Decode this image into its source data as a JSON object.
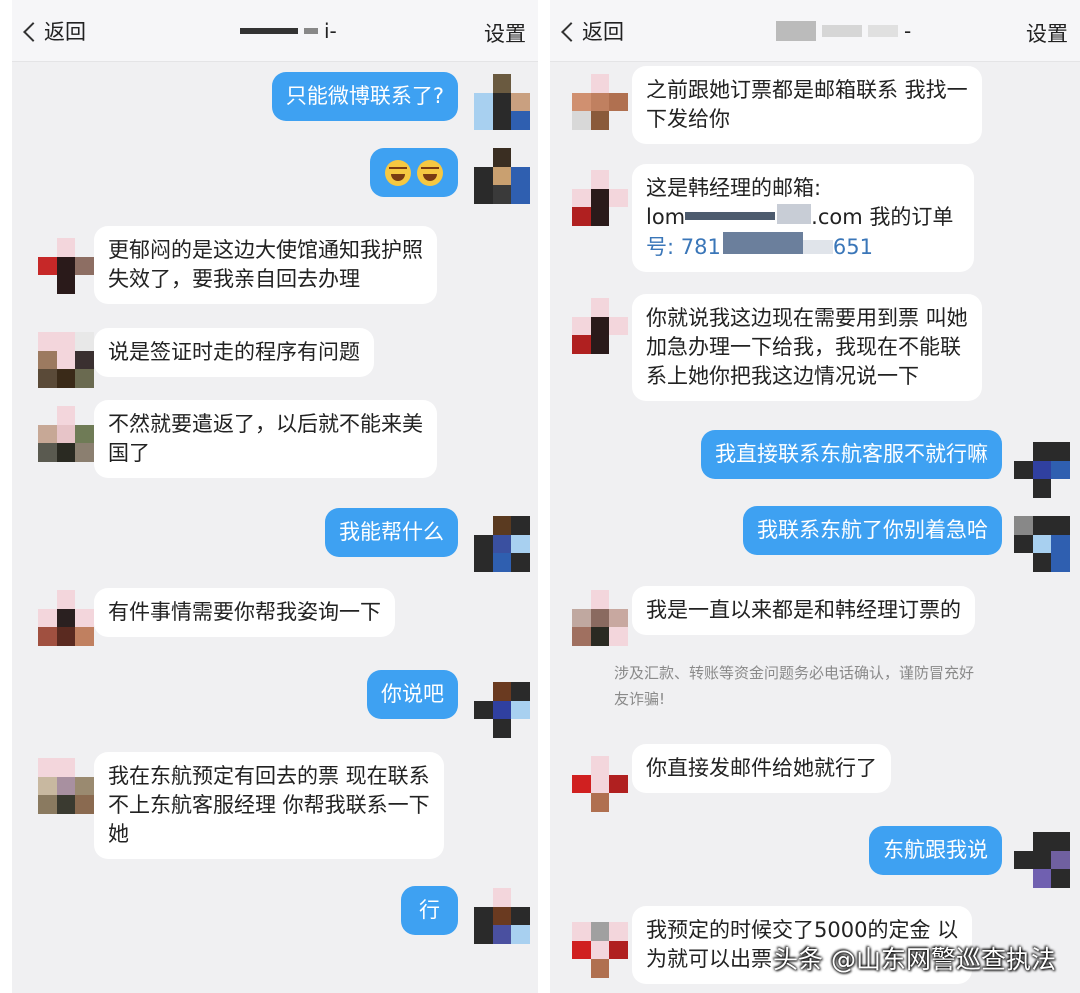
{
  "left": {
    "header": {
      "back": "返回",
      "title": "i-",
      "settings": "设置"
    },
    "messages": [
      {
        "dir": "out",
        "text": "只能微博联系了?"
      },
      {
        "dir": "out",
        "emoji": [
          "laughing-crying-emoji",
          "laughing-crying-emoji"
        ]
      },
      {
        "dir": "in",
        "lines": [
          "更郁闷的是这边大使馆通知我护照",
          "失效了，要我亲自回去办理"
        ]
      },
      {
        "dir": "in",
        "lines": [
          "说是签证时走的程序有问题"
        ]
      },
      {
        "dir": "in",
        "lines": [
          "不然就要遣返了，以后就不能来美",
          "国了"
        ]
      },
      {
        "dir": "out",
        "text": "我能帮什么"
      },
      {
        "dir": "in",
        "lines": [
          "有件事情需要你帮我姿询一下"
        ]
      },
      {
        "dir": "out",
        "text": "你说吧"
      },
      {
        "dir": "in",
        "lines": [
          "我在东航预定有回去的票 现在联系",
          "不上东航客服经理 你帮我联系一下",
          "她"
        ]
      },
      {
        "dir": "out",
        "text": "行"
      }
    ]
  },
  "right": {
    "header": {
      "back": "返回",
      "title": "-",
      "settings": "设置"
    },
    "messages": [
      {
        "dir": "in",
        "lines": [
          "之前跟她订票都是邮箱联系 我找一",
          "下发给你"
        ]
      },
      {
        "dir": "in",
        "lines": [
          "这是韩经理的邮箱:",
          "lom",
          ".com 我的订单",
          "号: 781",
          "651"
        ]
      },
      {
        "dir": "in",
        "lines": [
          "你就说我这边现在需要用到票 叫她",
          "加急办理一下给我，我现在不能联",
          "系上她你把我这边情况说一下"
        ]
      },
      {
        "dir": "out",
        "text": "我直接联系东航客服不就行嘛"
      },
      {
        "dir": "out",
        "text": "我联系东航了你别着急哈"
      },
      {
        "dir": "in",
        "lines": [
          "我是一直以来都是和韩经理订票的"
        ]
      },
      {
        "dir": "in",
        "lines": [
          "你直接发邮件给她就行了"
        ]
      },
      {
        "dir": "out",
        "text": "东航跟我说"
      },
      {
        "dir": "in",
        "lines": [
          "我预定的时候交了5000的定金 以",
          "为就可以出票"
        ]
      }
    ],
    "notice": [
      "涉及汇款、转账等资金问题务必电话确认，谨防冒充好",
      "友诈骗!"
    ]
  },
  "watermark": "头条 @山东网警巡查执法"
}
